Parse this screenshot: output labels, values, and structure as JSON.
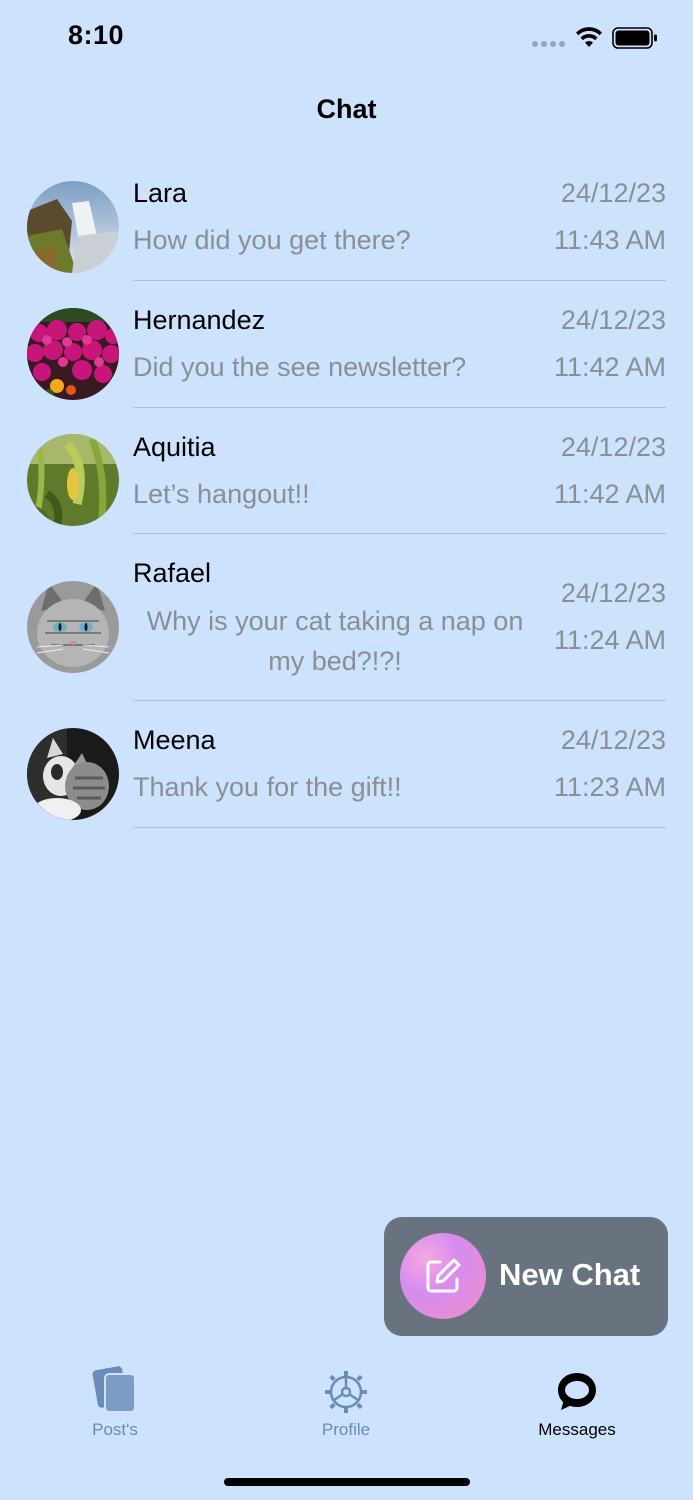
{
  "status_bar": {
    "time": "8:10",
    "icons": [
      "signal-dots-icon",
      "wifi-icon",
      "battery-icon"
    ]
  },
  "nav": {
    "title": "Chat"
  },
  "chats": [
    {
      "name": "Lara",
      "message": "How did you get there?",
      "date": "24/12/23",
      "time": "11:43 AM",
      "avatar": "waterfall-photo"
    },
    {
      "name": "Hernandez",
      "message": "Did you the see newsletter?",
      "date": "24/12/23",
      "time": "11:42 AM",
      "avatar": "flowers-photo"
    },
    {
      "name": "Aquitia",
      "message": "Let’s hangout!!",
      "date": "24/12/23",
      "time": "11:42 AM",
      "avatar": "leaves-photo"
    },
    {
      "name": "Rafael",
      "message": "Why is your cat taking a nap on my bed?!?!",
      "date": "24/12/23",
      "time": "11:24 AM",
      "avatar": "cat-photo"
    },
    {
      "name": "Meena",
      "message": "Thank you for the gift!!",
      "date": "24/12/23",
      "time": "11:23 AM",
      "avatar": "cats-bw-photo"
    }
  ],
  "new_chat": {
    "label": "New Chat",
    "icon": "compose-icon"
  },
  "tabs": [
    {
      "label": "Post's",
      "icon": "posts-icon",
      "active": false
    },
    {
      "label": "Profile",
      "icon": "gear-icon",
      "active": false
    },
    {
      "label": "Messages",
      "icon": "chat-bubble-icon",
      "active": true
    }
  ],
  "colors": {
    "background": "#cde2fd",
    "secondary_text": "#8a8f96",
    "new_chat_bg": "#68737f",
    "tab_inactive": "#6b8cb8"
  }
}
